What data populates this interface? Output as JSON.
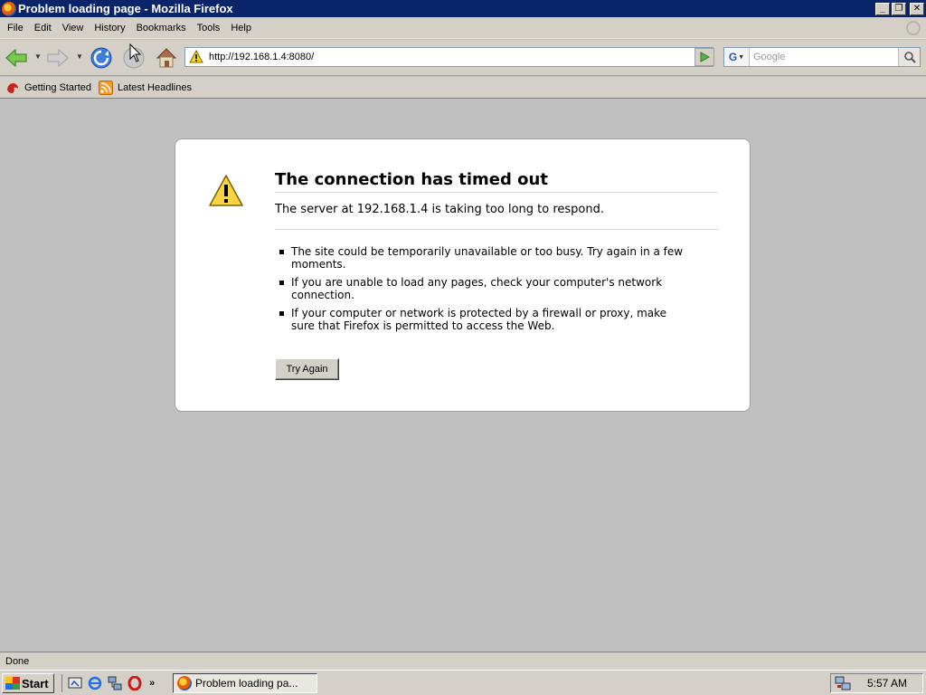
{
  "window": {
    "title": "Problem loading page - Mozilla Firefox",
    "controls": [
      "_",
      "❐",
      "✕"
    ]
  },
  "menu": [
    {
      "accel": "F",
      "rest": "ile"
    },
    {
      "accel": "E",
      "rest": "dit"
    },
    {
      "accel": "V",
      "rest": "iew"
    },
    {
      "accel": "",
      "pre": "Hi",
      "accel2": "s",
      "rest": "tory"
    },
    {
      "accel": "B",
      "rest": "ookmarks"
    },
    {
      "accel": "T",
      "rest": "ools"
    },
    {
      "accel": "H",
      "rest": "elp"
    }
  ],
  "menu_labels": [
    "File",
    "Edit",
    "View",
    "History",
    "Bookmarks",
    "Tools",
    "Help"
  ],
  "navbar": {
    "url": "http://192.168.1.4:8080/",
    "search_placeholder": "Google",
    "search_engine": "G"
  },
  "bookmarks": [
    {
      "label": "Getting Started",
      "icon": "firefox-icon"
    },
    {
      "label": "Latest Headlines",
      "icon": "rss-icon"
    }
  ],
  "error": {
    "title": "The connection has timed out",
    "short": "The server at 192.168.1.4 is taking too long to respond.",
    "items": [
      "The site could be temporarily unavailable or too busy. Try again in a few moments.",
      "If you are unable to load any pages, check your computer's network connection.",
      "If your computer or network is protected by a firewall or proxy, make sure that Firefox is permitted to access the Web."
    ],
    "try_again": "Try Again"
  },
  "status": {
    "text": "Done"
  },
  "taskbar": {
    "start": "Start",
    "task_label": "Problem loading pa...",
    "clock": "5:57 AM",
    "overflow": "»"
  },
  "colors": {
    "titlebar": "#0a246a",
    "chrome": "#d4d0c8",
    "content_bg": "#c0c0c0"
  }
}
